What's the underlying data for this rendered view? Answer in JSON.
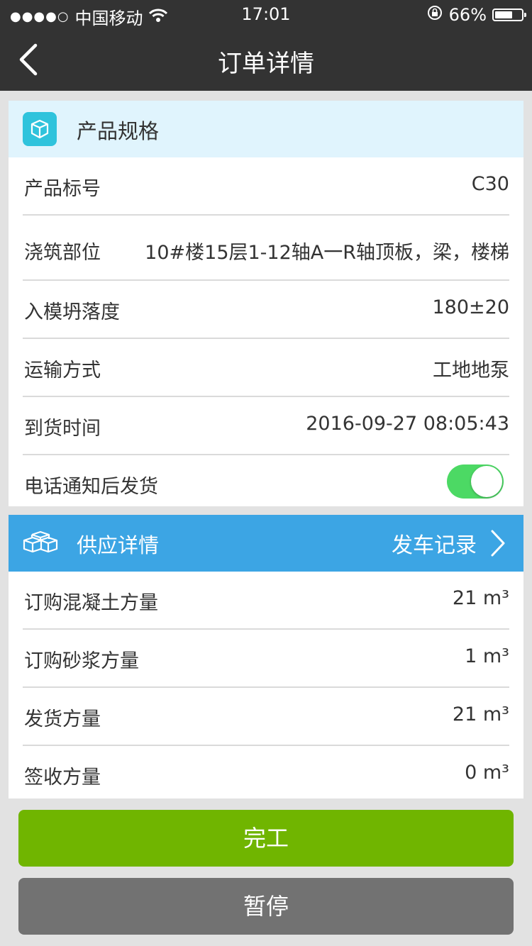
{
  "status_bar": {
    "signal": "●●●●○",
    "carrier": "中国移动",
    "time": "17:01",
    "battery": "66%",
    "battery_level": 0.66
  },
  "nav": {
    "title": "订单详情"
  },
  "product_spec": {
    "title": "产品规格",
    "icon_color": "#2fc3dc",
    "rows": [
      {
        "label": "产品标号",
        "value": "C30"
      },
      {
        "label": "浇筑部位",
        "value": "10#楼15层1-12轴A一R轴顶板，梁，楼梯"
      },
      {
        "label": "入模坍落度",
        "value": "180±20"
      },
      {
        "label": "运输方式",
        "value": "工地地泵"
      },
      {
        "label": "到货时间",
        "value": "2016-09-27 08:05:43"
      }
    ],
    "toggle_row": {
      "label": "电话通知后发货",
      "on": true
    }
  },
  "supply": {
    "title": "供应详情",
    "link_label": "发车记录",
    "header_color": "#3ca5e4",
    "rows": [
      {
        "label": "订购混凝土方量",
        "value": "21 m³"
      },
      {
        "label": "订购砂浆方量",
        "value": "1 m³"
      },
      {
        "label": "发货方量",
        "value": "21 m³"
      },
      {
        "label": "签收方量",
        "value": "0 m³"
      }
    ]
  },
  "buttons": {
    "complete": {
      "label": "完工",
      "color": "#70b500"
    },
    "pause": {
      "label": "暂停",
      "color": "#727272"
    }
  }
}
